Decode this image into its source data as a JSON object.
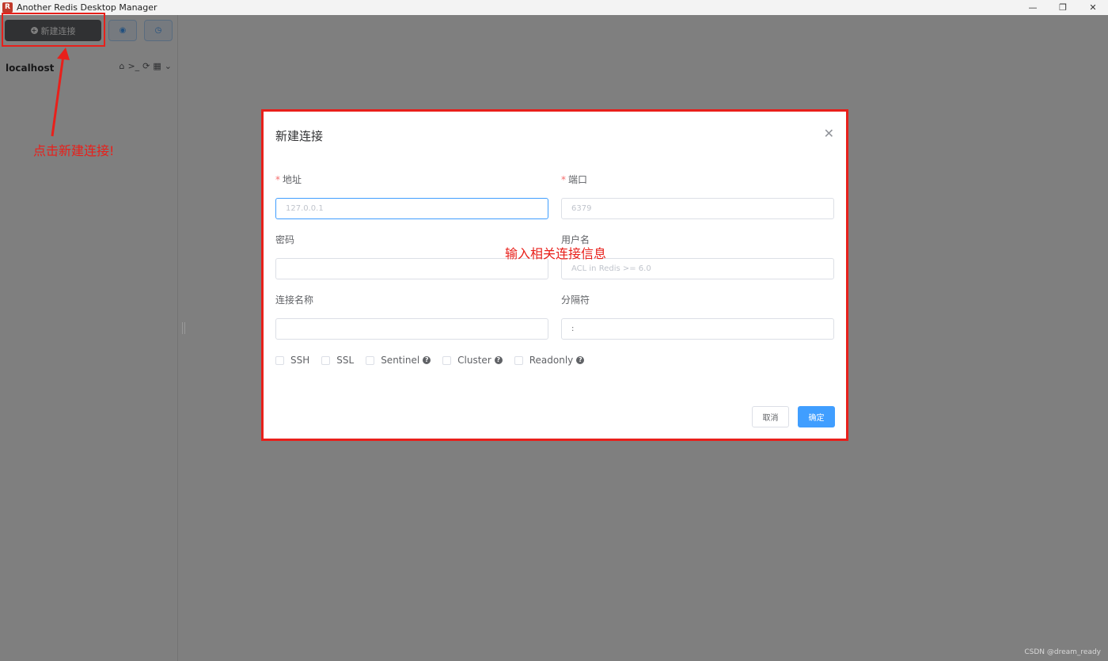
{
  "window": {
    "app_icon_glyph": "R",
    "title": "Another Redis Desktop Manager",
    "controls": {
      "minimize": "—",
      "restore": "❐",
      "close": "✕"
    }
  },
  "toolbar": {
    "new_connection_label": "新建连接",
    "plus_glyph": "+",
    "status_glyph": "◉",
    "history_glyph": "◷"
  },
  "sidebar": {
    "connection_name": "localhost",
    "icons": {
      "home": "⌂",
      "terminal": ">_",
      "refresh": "⟳",
      "grid": "▦",
      "chevron": "⌄"
    }
  },
  "annotations": {
    "click_hint": "点击新建连接!",
    "input_hint": "输入相关连接信息",
    "color": "#e8201b"
  },
  "dialog": {
    "title": "新建连接",
    "close_glyph": "✕",
    "required_mark": "*",
    "fields": {
      "host": {
        "label": "地址",
        "value": "",
        "placeholder": "127.0.0.1"
      },
      "port": {
        "label": "端口",
        "value": "",
        "placeholder": "6379"
      },
      "password": {
        "label": "密码",
        "value": "",
        "placeholder": ""
      },
      "username": {
        "label": "用户名",
        "value": "",
        "placeholder": "ACL in Redis >= 6.0"
      },
      "conn_name": {
        "label": "连接名称",
        "value": "",
        "placeholder": ""
      },
      "separator": {
        "label": "分隔符",
        "value": ":",
        "placeholder": ""
      }
    },
    "options": {
      "ssh": "SSH",
      "ssl": "SSL",
      "sentinel": "Sentinel",
      "cluster": "Cluster",
      "readonly": "Readonly",
      "help_glyph": "?"
    },
    "cancel_label": "取消",
    "ok_label": "确定"
  },
  "watermark": "CSDN @dream_ready",
  "colors": {
    "primary": "#409eff",
    "overlay": "rgba(0,0,0,0.5)",
    "annotation": "#e8201b"
  }
}
